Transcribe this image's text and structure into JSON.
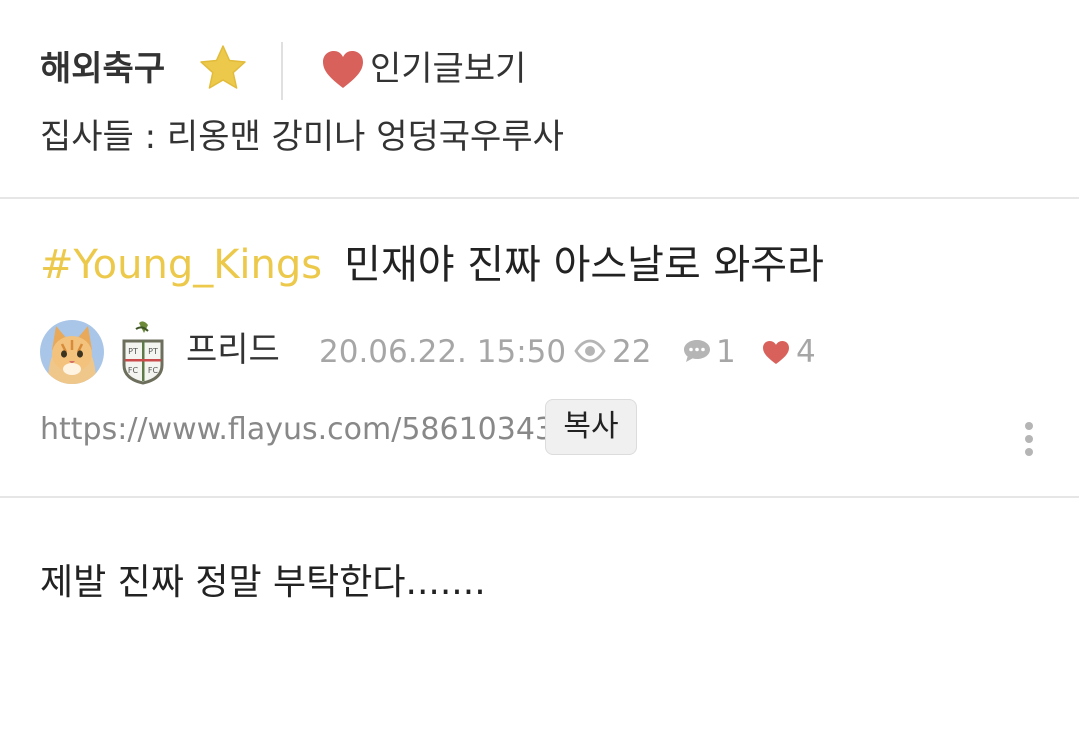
{
  "board": {
    "name": "해외축구",
    "favorite_icon": "star-icon",
    "popular_label": "인기글보기",
    "popular_icon": "heart-icon",
    "managers": "집사들 : 리옹맨 강미나 엉덩국우루사"
  },
  "post": {
    "tag": "#Young_Kings",
    "title": "민재야 진짜 아스날로 와주라",
    "author": "프리드",
    "date": "20.06.22. 15:50",
    "views": "22",
    "comments": "1",
    "likes": "4",
    "url": "https://www.flayus.com/58610343",
    "copy_label": "복사",
    "body": "제발 진짜 정말 부탁한다......."
  },
  "colors": {
    "tag": "#ecc94a",
    "heart": "#d9615b",
    "star": "#ecc94a",
    "meta_gray": "#a6a6a6",
    "divider": "#e6e6e6"
  }
}
